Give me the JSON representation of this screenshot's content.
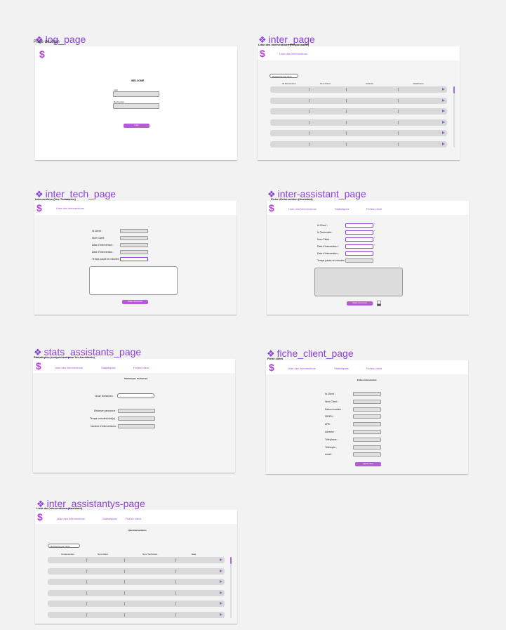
{
  "pages": {
    "log": {
      "title": "log_page",
      "sub": "Page de login",
      "welcome": "WELCOME",
      "f1": "Login",
      "f2": "Mot de passe",
      "btn": "Login"
    },
    "inter": {
      "title": "inter_page",
      "sub": "Liste des interventions (Responsable)",
      "nav1": "Liste des interventions",
      "search": "Recherche par client",
      "cols": [
        "ID Intervention",
        "Nom Client",
        "Adresse",
        "Date/heure"
      ]
    },
    "inter_tech": {
      "title": "inter_tech_page",
      "sub": "Interventions (Vue Technicien)",
      "nav1": "Liste des interventions",
      "labels": [
        "Id Client :",
        "Nom Client :",
        "Date d'Intervention :",
        "Date d'Intervention :",
        "Temps passé en minutes :"
      ],
      "btn": "Valider intervention"
    },
    "inter_assistant": {
      "title": "inter-assistant_page",
      "sub": "Fiche d'intervention (Assistant)",
      "nav1": "Liste des interventions",
      "nav2": "Statistiques",
      "nav3": "Fiches client",
      "labels": [
        "Id Client :",
        "Id Technicien :",
        "Nom Client :",
        "Date d'intervention :",
        "Date d'intervention :",
        "Temps passé en minutes :"
      ],
      "btn": "Valider intervention",
      "star": "*"
    },
    "stats": {
      "title": "stats_assistants_page",
      "sub": "Statistiques (uniquement pour les Assistants)",
      "nav1": "Liste des interventions",
      "nav2": "Statistiques",
      "nav3": "Fiches client",
      "heading": "Statistiques Technicien",
      "labels": [
        "Choix technicien :",
        "Distance parcourue :",
        "Temps cumulés total(s) :",
        "Nombre d'interventions :"
      ]
    },
    "fiche": {
      "title": "fiche_client_page",
      "sub": "Fiche client",
      "nav1": "Liste des interventions",
      "nav2": "Statistiques",
      "nav3": "Fiches client",
      "heading": "Fiches intervention",
      "labels": [
        "Id Client :",
        "Nom Client :",
        "Raison sociale :",
        "SIREN :",
        "APE :",
        "Adresse :",
        "Téléphone :",
        "Télécopie :",
        "email :"
      ],
      "btn": "Ajouter client"
    },
    "assistantys": {
      "title": "inter_assistantys-page",
      "sub": "Liste des interventions (Assistant)",
      "nav1": "Liste des interventions",
      "nav2": "Statistiques",
      "nav3": "Fiches client",
      "heading": "Liste interventions",
      "search": "Recherche par client",
      "cols": [
        "Id intervention",
        "Nom Client",
        "Nom Technicien",
        "Date"
      ]
    }
  },
  "icons": {
    "logo": "dollar-logo",
    "title_marker": "diamond-component-icon"
  },
  "colors": {
    "accent": "#8b3fd9",
    "button": "#b45bd6"
  }
}
